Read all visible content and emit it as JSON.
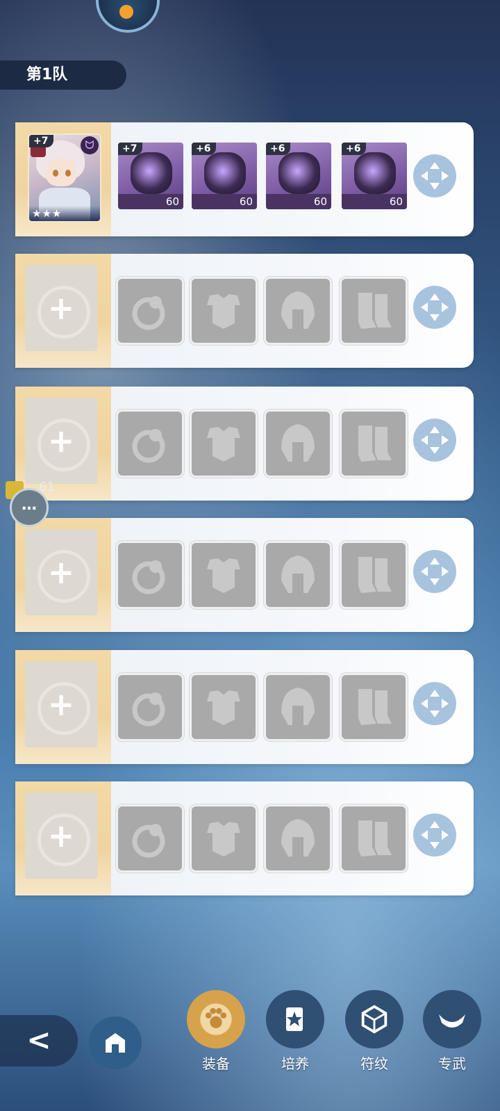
{
  "team": {
    "title": "第1队"
  },
  "hero": {
    "plus": "+7",
    "stars": "★★★",
    "badge": "ᗢ"
  },
  "equipment": [
    {
      "slot": "ring",
      "plus": "+7",
      "level": "60"
    },
    {
      "slot": "armor",
      "plus": "+6",
      "level": "60"
    },
    {
      "slot": "helmet",
      "plus": "+6",
      "level": "60"
    },
    {
      "slot": "boots",
      "plus": "+6",
      "level": "60"
    }
  ],
  "empty_rows": [
    {
      "plus": "+"
    },
    {
      "plus": "+"
    },
    {
      "plus": "+"
    },
    {
      "plus": "+"
    },
    {
      "plus": "+"
    }
  ],
  "chat": {
    "count": "61",
    "icon": "chat-bubble-icon"
  },
  "nav": {
    "back_icon": "<",
    "items": [
      {
        "label": "装备",
        "icon": "paw-medal-icon",
        "active": true
      },
      {
        "label": "培养",
        "icon": "card-icon",
        "active": false
      },
      {
        "label": "符纹",
        "icon": "dice-icon",
        "active": false
      },
      {
        "label": "专武",
        "icon": "horn-weapon-icon",
        "active": false
      }
    ]
  },
  "colors": {
    "accent": "#d6a24b",
    "row_bg": "#f3f6fa",
    "hero_slot": "#f3d9a6",
    "empty_slot": "#a9a9a9"
  }
}
